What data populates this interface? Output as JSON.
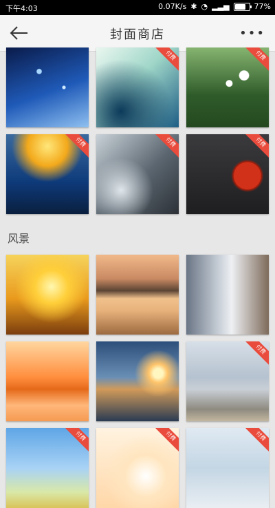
{
  "status": {
    "time": "下午4:03",
    "network_speed": "0.07K/s",
    "battery_percent": "77%",
    "battery_level": 0.77
  },
  "header": {
    "title": "封面商店",
    "more": "•••"
  },
  "sections": [
    {
      "title": "",
      "items": [
        {
          "name": "bokeh-blue",
          "badge": ""
        },
        {
          "name": "frost-branches",
          "badge": "付费"
        },
        {
          "name": "daisies-windmill",
          "badge": "付费"
        },
        {
          "name": "blue-grass",
          "badge": "付费"
        },
        {
          "name": "dandelion-mono",
          "badge": "付费"
        },
        {
          "name": "red-pendant",
          "badge": "付费"
        }
      ]
    },
    {
      "title": "风景",
      "items": [
        {
          "name": "sunny-street-lamp",
          "badge": ""
        },
        {
          "name": "lake-boat",
          "badge": ""
        },
        {
          "name": "wall-street",
          "badge": ""
        },
        {
          "name": "orange-sunset-sea",
          "badge": ""
        },
        {
          "name": "lighthouse-sunset",
          "badge": ""
        },
        {
          "name": "pier-sky",
          "badge": "付费"
        },
        {
          "name": "blue-sky-field",
          "badge": "付费"
        },
        {
          "name": "bright-sun-grass",
          "badge": "付费"
        },
        {
          "name": "winter-twigs",
          "badge": "付费"
        }
      ]
    }
  ]
}
